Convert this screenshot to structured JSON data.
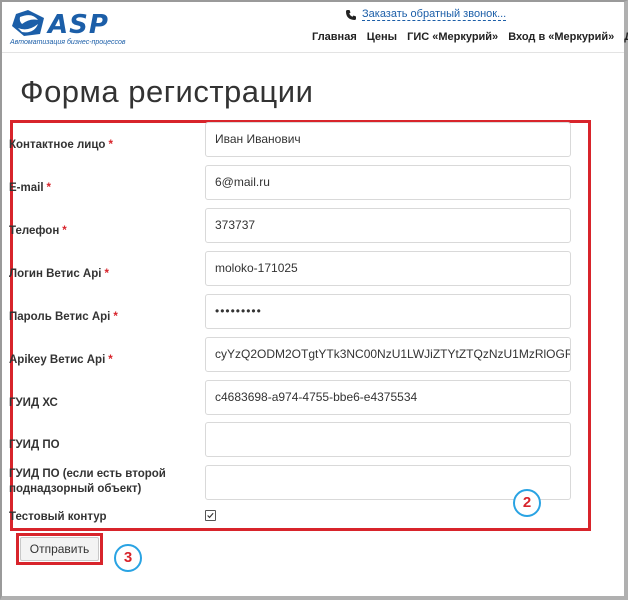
{
  "header": {
    "logo_text": "ASP",
    "logo_subtitle": "Автоматизация бизнес-процессов",
    "callback_label": "Заказать обратный звонок...",
    "nav": [
      "Главная",
      "Цены",
      "ГИС «Меркурий»",
      "Вход в «Меркурий»",
      "Дл"
    ]
  },
  "page_title": "Форма регистрации",
  "form": {
    "fields": [
      {
        "label": "Контактное лицо",
        "required": "*",
        "value": "Иван Иванович"
      },
      {
        "label": "E-mail",
        "required": "*",
        "value": "6@mail.ru"
      },
      {
        "label": "Телефон",
        "required": "*",
        "value": "373737"
      },
      {
        "label": "Логин Ветис Api",
        "required": "*",
        "value": "moloko-171025"
      },
      {
        "label": "Пароль Ветис Api",
        "required": "*",
        "value": "•••••••••"
      },
      {
        "label": "Apikey Ветис Api",
        "required": "*",
        "value": "cyYzQ2ODM2OTgtYTk3NC00NzU1LWJiZTYtZTQzNzU1MzRlOGRi"
      },
      {
        "label": "ГУИД ХС",
        "required": "",
        "value": "c4683698-a974-4755-bbe6-e4375534"
      },
      {
        "label": "ГУИД ПО",
        "required": "",
        "value": ""
      },
      {
        "label_line1": "ГУИД ПО (если есть второй",
        "label_line2": "поднадзорный объект)",
        "value": ""
      }
    ],
    "test_contour_label": "Тестовый контур",
    "test_contour_checked": true,
    "submit_label": "Отправить"
  },
  "annotations": {
    "form_badge": "2",
    "submit_badge": "3"
  },
  "colors": {
    "brand": "#1b5ea8",
    "highlight": "#d8242b",
    "badge_ring": "#29a3e3"
  }
}
